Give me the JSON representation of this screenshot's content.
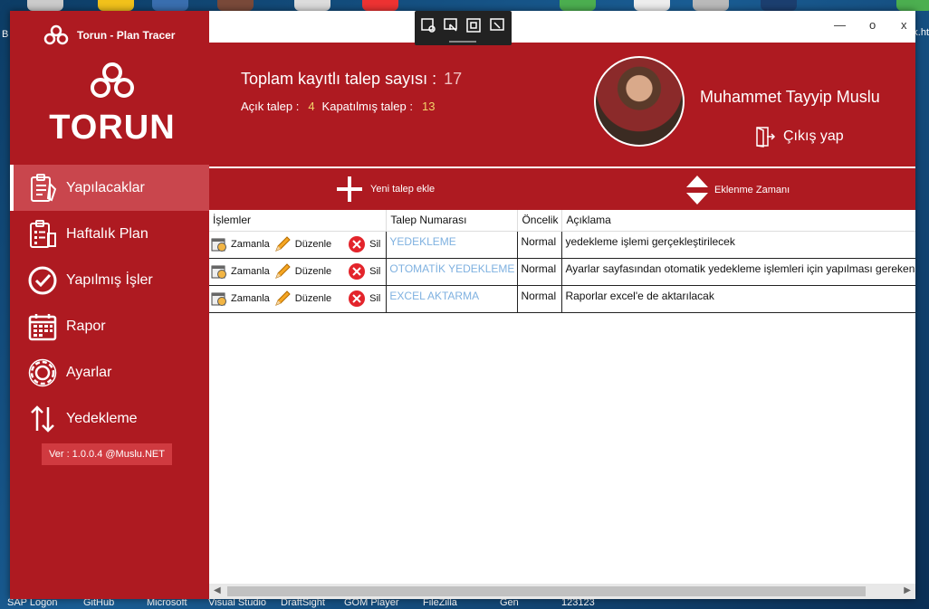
{
  "app": {
    "title": "Torun - Plan Tracer",
    "logo_text": "TORUN"
  },
  "window_controls": {
    "minimize": "—",
    "maximize": "o",
    "close": "x"
  },
  "nav": {
    "items": [
      {
        "label": "Yapılacaklar",
        "icon": "clipboard-list-icon",
        "active": true
      },
      {
        "label": "Haftalık Plan",
        "icon": "weekly-plan-icon",
        "active": false
      },
      {
        "label": "Yapılmış İşler",
        "icon": "check-circle-icon",
        "active": false
      },
      {
        "label": "Rapor",
        "icon": "calendar-icon",
        "active": false
      },
      {
        "label": "Ayarlar",
        "icon": "gear-icon",
        "active": false
      },
      {
        "label": "Yedekleme",
        "icon": "up-down-arrows-icon",
        "active": false
      }
    ],
    "version": "Ver : 1.0.0.4 @Muslu.NET"
  },
  "header": {
    "total_label": "Toplam kayıtlı talep sayısı :",
    "total_value": "17",
    "open_label": "Açık talep :",
    "open_value": "4",
    "closed_label": "Kapatılmış talep :",
    "closed_value": "13",
    "user_name": "Muhammet Tayyip Muslu",
    "logout_label": "Çıkış yap"
  },
  "toolbar": {
    "add_label": "Yeni talep ekle",
    "sort_label": "Eklenme Zamanı"
  },
  "table": {
    "columns": [
      "İşlemler",
      "Talep Numarası",
      "Öncelik",
      "Açıklama"
    ],
    "op_labels": {
      "schedule": "Zamanla",
      "edit": "Düzenle",
      "delete": "Sil"
    },
    "rows": [
      {
        "talep": "YEDEKLEME",
        "oncelik": "Normal",
        "aciklama": "yedekleme işlemi gerçekleştirilecek"
      },
      {
        "talep": "OTOMATİK YEDEKLEME",
        "oncelik": "Normal",
        "aciklama": "Ayarlar sayfasından otomatik yedekleme işlemleri için yapılması gerekenle"
      },
      {
        "talep": "EXCEL AKTARMA",
        "oncelik": "Normal",
        "aciklama": "Raporlar excel'e de aktarılacak"
      }
    ]
  },
  "desktop": {
    "taskbar_labels": [
      "SAP Logon",
      "GitHub",
      "Microsoft",
      "Visual Studio",
      "DraftSight",
      "GOM Player",
      "FileZilla",
      "Gen",
      "123123"
    ],
    "left_edge_text": "B",
    "right_edge_text": "k.ht"
  },
  "colors": {
    "brand_red": "#ae1a21",
    "active_nav": "#c9464d",
    "link_blue": "#7fb1e0",
    "accent_yellow": "#f3d36a"
  }
}
